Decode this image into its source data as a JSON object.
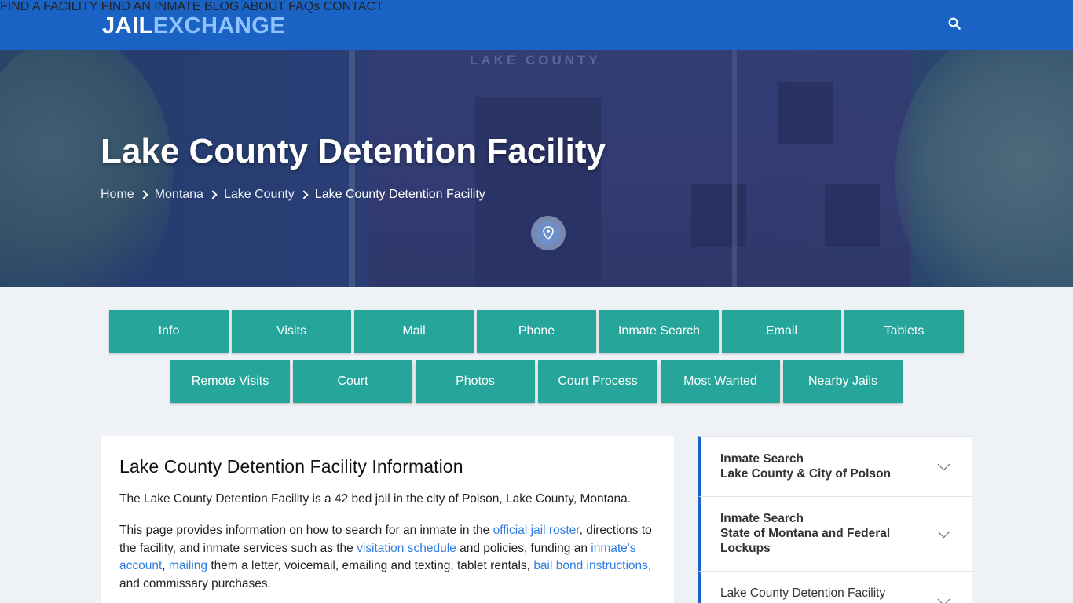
{
  "brand": {
    "part1": "JAIL",
    "part2": "EXCHANGE"
  },
  "nav": {
    "items": [
      {
        "label": "FIND A FACILITY"
      },
      {
        "label": "FIND AN INMATE"
      },
      {
        "label": "BLOG"
      },
      {
        "label": "ABOUT"
      },
      {
        "label": "FAQs"
      },
      {
        "label": "CONTACT"
      }
    ],
    "search_icon": "search-icon"
  },
  "hero": {
    "sign": "LAKE   COUNTY",
    "title": "Lake County Detention Facility",
    "breadcrumb": [
      "Home",
      "Montana",
      "Lake County",
      "Lake County Detention Facility"
    ],
    "pin_icon": "map-pin-icon"
  },
  "buttons": {
    "row1": [
      "Info",
      "Visits",
      "Mail",
      "Phone",
      "Inmate Search",
      "Email",
      "Tablets"
    ],
    "row2": [
      "Remote Visits",
      "Court",
      "Photos",
      "Court Process",
      "Most Wanted",
      "Nearby Jails"
    ]
  },
  "info": {
    "heading": "Lake County Detention Facility Information",
    "p1": "The Lake County Detention Facility is a 42 bed jail in the city of Polson, Lake County, Montana.",
    "p2_parts": {
      "a": "This page provides information on how to search for an inmate in the ",
      "link1": "official jail roster",
      "b": ", directions to the facility, and inmate services such as the ",
      "link2": "visitation schedule",
      "c": " and policies, funding an ",
      "link3": "inmate's account",
      "d": ", ",
      "link4": "mailing",
      "e": " them a letter, voicemail, emailing and texting, tablet rentals, ",
      "link5": "bail bond instructions",
      "f": ", and commissary purchases."
    }
  },
  "sidebar": {
    "items": [
      {
        "line1": "Inmate Search",
        "line2": "Lake County & City of Polson"
      },
      {
        "line1": "Inmate Search",
        "line2": "State of Montana and Federal",
        "line3": "Lockups"
      },
      {
        "line1": "Lake County Detention Facility"
      }
    ]
  },
  "colors": {
    "nav_bg": "#1a63c4",
    "button_bg": "#26a69a",
    "link": "#2f7de1",
    "accent": "#1a63c4"
  }
}
